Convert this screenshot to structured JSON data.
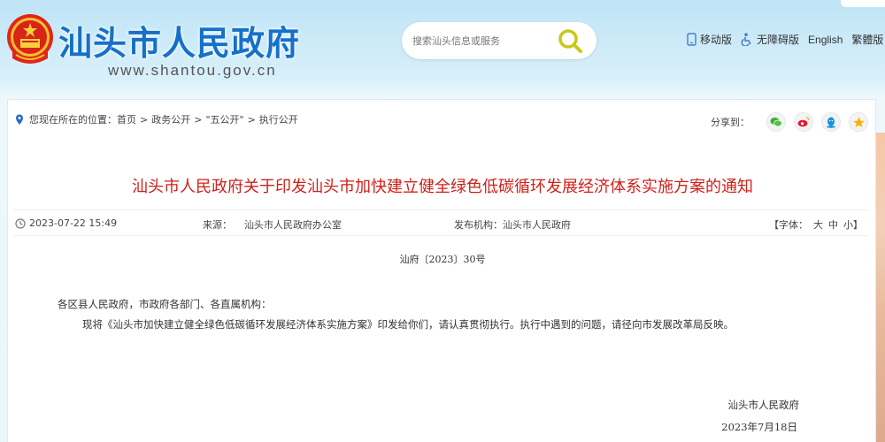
{
  "header": {
    "site_title": "汕头市人民政府",
    "site_url": "www.shantou.gov.cn",
    "search_placeholder": "搜索汕头信息或服务",
    "links": {
      "mobile": "移动版",
      "accessible": "无障碍版",
      "english": "English",
      "traditional": "繁體版"
    },
    "emblem_icon": "national-emblem-icon",
    "accent_color": "#1670c8"
  },
  "breadcrumb": {
    "prefix": "您现在所在的位置：",
    "items": [
      "首页",
      "政务公开",
      "\"五公开\"",
      "执行公开"
    ],
    "separator": ">"
  },
  "share": {
    "label": "分享到：",
    "icons": [
      "wechat-icon",
      "weibo-icon",
      "qq-icon",
      "qzone-icon"
    ]
  },
  "article": {
    "title": "汕头市人民政府关于印发汕头市加快建立健全绿色低碳循环发展经济体系实施方案的通知",
    "title_color": "#d0201a",
    "date": "2023-07-22 15:49",
    "source_label": "来源：",
    "source_value": "汕头市人民政府办公室",
    "publisher_label": "发布机构：",
    "publisher_value": "汕头市人民政府",
    "font_label": "【字体：",
    "font_large": "大",
    "font_medium": "中",
    "font_small": "小】",
    "doc_number": "汕府〔2023〕30号",
    "salutation": "各区县人民政府，市政府各部门、各直属机构：",
    "paragraph": "现将《汕头市加快建立健全绿色低碳循环发展经济体系实施方案》印发给你们，请认真贯彻执行。执行中遇到的问题，请径向市发展改革局反映。",
    "signature": "汕头市人民政府",
    "sign_date": "2023年7月18日"
  }
}
